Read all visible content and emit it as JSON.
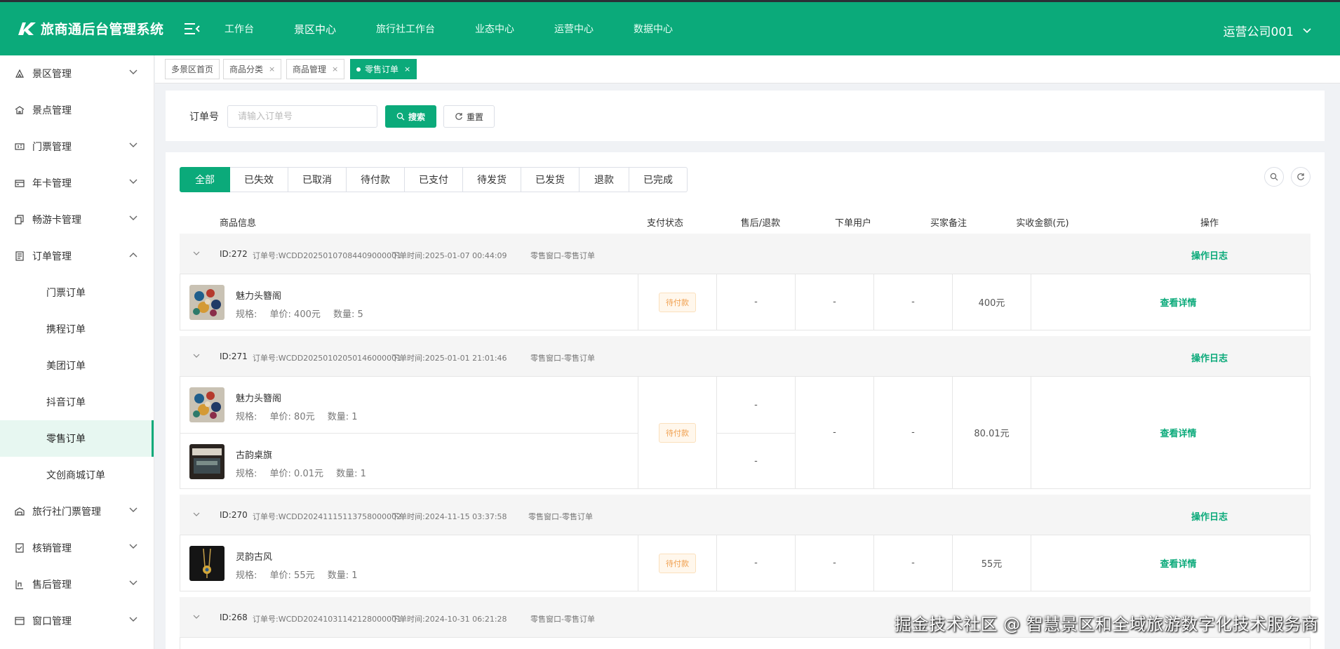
{
  "app": {
    "title": "旅商通后台管理系统",
    "user": "运营公司001"
  },
  "topnav": [
    {
      "label": "工作台"
    },
    {
      "label": "景区中心"
    },
    {
      "label": "旅行社工作台"
    },
    {
      "label": "业态中心"
    },
    {
      "label": "运营中心"
    },
    {
      "label": "数据中心"
    }
  ],
  "sidebar": {
    "items": [
      {
        "label": "景区管理",
        "icon": "scenic-icon"
      },
      {
        "label": "景点管理",
        "icon": "attraction-icon"
      },
      {
        "label": "门票管理",
        "icon": "ticket-icon"
      },
      {
        "label": "年卡管理",
        "icon": "card-icon"
      },
      {
        "label": "畅游卡管理",
        "icon": "pass-icon"
      },
      {
        "label": "订单管理",
        "icon": "order-icon"
      }
    ],
    "order_sub": [
      {
        "label": "门票订单"
      },
      {
        "label": "携程订单"
      },
      {
        "label": "美团订单"
      },
      {
        "label": "抖音订单"
      },
      {
        "label": "零售订单"
      },
      {
        "label": "文创商城订单"
      }
    ],
    "items_after": [
      {
        "label": "旅行社门票管理",
        "icon": "agency-icon"
      },
      {
        "label": "核销管理",
        "icon": "verify-icon"
      },
      {
        "label": "售后管理",
        "icon": "aftersale-icon"
      },
      {
        "label": "窗口管理",
        "icon": "window-icon"
      }
    ]
  },
  "tabs": [
    {
      "label": "多景区首页"
    },
    {
      "label": "商品分类"
    },
    {
      "label": "商品管理"
    },
    {
      "label": "零售订单"
    }
  ],
  "search": {
    "label": "订单号",
    "placeholder": "请输入订单号",
    "value": "",
    "search_label": "搜索",
    "reset_label": "重置"
  },
  "status_tabs": [
    {
      "label": "全部"
    },
    {
      "label": "已失效"
    },
    {
      "label": "已取消"
    },
    {
      "label": "待付款"
    },
    {
      "label": "已支付"
    },
    {
      "label": "待发货"
    },
    {
      "label": "已发货"
    },
    {
      "label": "退款"
    },
    {
      "label": "已完成"
    }
  ],
  "columns": {
    "product": "商品信息",
    "pay_status": "支付状态",
    "aftersale": "售后/退款",
    "user": "下单用户",
    "remark": "买家备注",
    "amount": "实收金额(元)",
    "action": "操作"
  },
  "orders": [
    {
      "id": "ID:272",
      "order_no": "订单号:WCDD20250107084409000001",
      "time": "下单时间:2025-01-07 00:44:09",
      "channel": "零售窗口-零售订单",
      "log": "操作日志",
      "status": "待付款",
      "user": "-",
      "remark": "-",
      "amount": "400元",
      "detail": "查看详情",
      "products": [
        {
          "name": "魅力头簪阁",
          "spec": "规格:",
          "price": "单价:  400元",
          "qty": "数量:  5",
          "aftersale": "-"
        }
      ]
    },
    {
      "id": "ID:271",
      "order_no": "订单号:WCDD20250102050146000001",
      "time": "下单时间:2025-01-01 21:01:46",
      "channel": "零售窗口-零售订单",
      "log": "操作日志",
      "status": "待付款",
      "user": "-",
      "remark": "-",
      "amount": "80.01元",
      "detail": "查看详情",
      "products": [
        {
          "name": "魅力头簪阁",
          "spec": "规格:",
          "price": "单价:  80元",
          "qty": "数量:  1",
          "aftersale": "-"
        },
        {
          "name": "古韵桌旗",
          "spec": "规格:",
          "price": "单价:  0.01元",
          "qty": "数量:  1",
          "aftersale": "-"
        }
      ]
    },
    {
      "id": "ID:270",
      "order_no": "订单号:WCDD20241115113758000002",
      "time": "下单时间:2024-11-15 03:37:58",
      "channel": "零售窗口-零售订单",
      "log": "操作日志",
      "status": "待付款",
      "user": "-",
      "remark": "-",
      "amount": "55元",
      "detail": "查看详情",
      "products": [
        {
          "name": "灵韵古风",
          "spec": "规格:",
          "price": "单价:  55元",
          "qty": "数量:  1",
          "aftersale": "-"
        }
      ]
    },
    {
      "id": "ID:268",
      "order_no": "订单号:WCDD20241031142128000001",
      "time": "下单时间:2024-10-31 06:21:28",
      "channel": "零售窗口-零售订单"
    }
  ],
  "watermark": "掘金技术社区 @ 智慧景区和全域旅游数字化技术服务商",
  "colors": {
    "brand": "#0baa7a",
    "pending": "#f0a050"
  }
}
